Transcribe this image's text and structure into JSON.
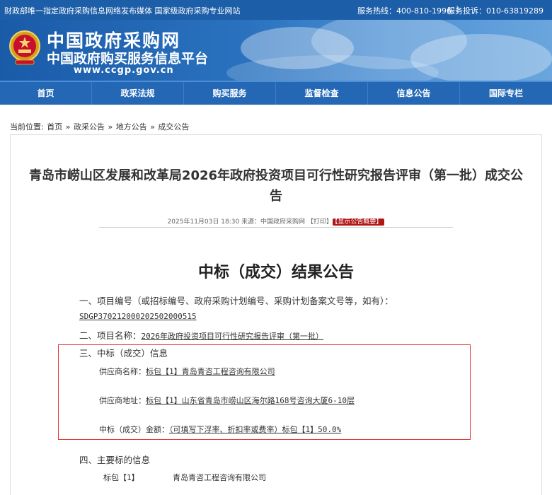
{
  "topbar": {
    "slogan": "财政部唯一指定政府采购信息网络发布媒体 国家级政府采购专业网站",
    "hotline": "服务热线：400-810-1996",
    "separator": "|",
    "complaint": "服务投诉：010-63819289"
  },
  "banner": {
    "title": "中国政府采购网",
    "subtitle": "中国政府购买服务信息平台",
    "url": "www.ccgp.gov.cn"
  },
  "nav": {
    "items": [
      {
        "label": "首页"
      },
      {
        "label": "政采法规"
      },
      {
        "label": "购买服务"
      },
      {
        "label": "监督检查"
      },
      {
        "label": "信息公告"
      },
      {
        "label": "国际专栏"
      }
    ]
  },
  "breadcrumb": {
    "prefix": "当前位置:",
    "items": [
      "首页",
      "政采公告",
      "地方公告",
      "成交公告"
    ],
    "separator": "»"
  },
  "article": {
    "title": "青岛市崂山区发展和改革局2026年政府投资项目可行性研究报告评审（第一批）成交公告",
    "meta": "2025年11月03日 18:30 来源：中国政府采购网 【打印】",
    "summary_badge": "【显示公告概要】",
    "heading": "中标（成交）结果公告",
    "sec1_label": "一、项目编号（或招标编号、政府采购计划编号、采购计划备案文号等，如有）：",
    "project_no": "SDGP370212000202502000515",
    "sec2_label": "二、项目名称：",
    "project_name": "2026年政府投资项目可行性研究报告评审（第一批）",
    "sec3_label": "三、中标（成交）信息",
    "supplier_name_label": "供应商名称：",
    "supplier_name_value": "标包【1】青岛青咨工程咨询有限公司",
    "supplier_addr_label": "供应商地址：",
    "supplier_addr_value": "标包【1】山东省青岛市崂山区海尔路168号咨询大厦6-10层",
    "amount_label": "中标（成交）金额：",
    "amount_value": "（可填写下浮率、折扣率或费率）标包【1】50.0%",
    "sec4_label": "四、主要标的信息",
    "lot_label": "标包【1】",
    "lot_company": "青岛青咨工程咨询有限公司"
  },
  "colors": {
    "topbar": "#1d5ea8",
    "nav": "#2367b5",
    "highlight_box": "#e53935",
    "badge": "#b01717"
  }
}
